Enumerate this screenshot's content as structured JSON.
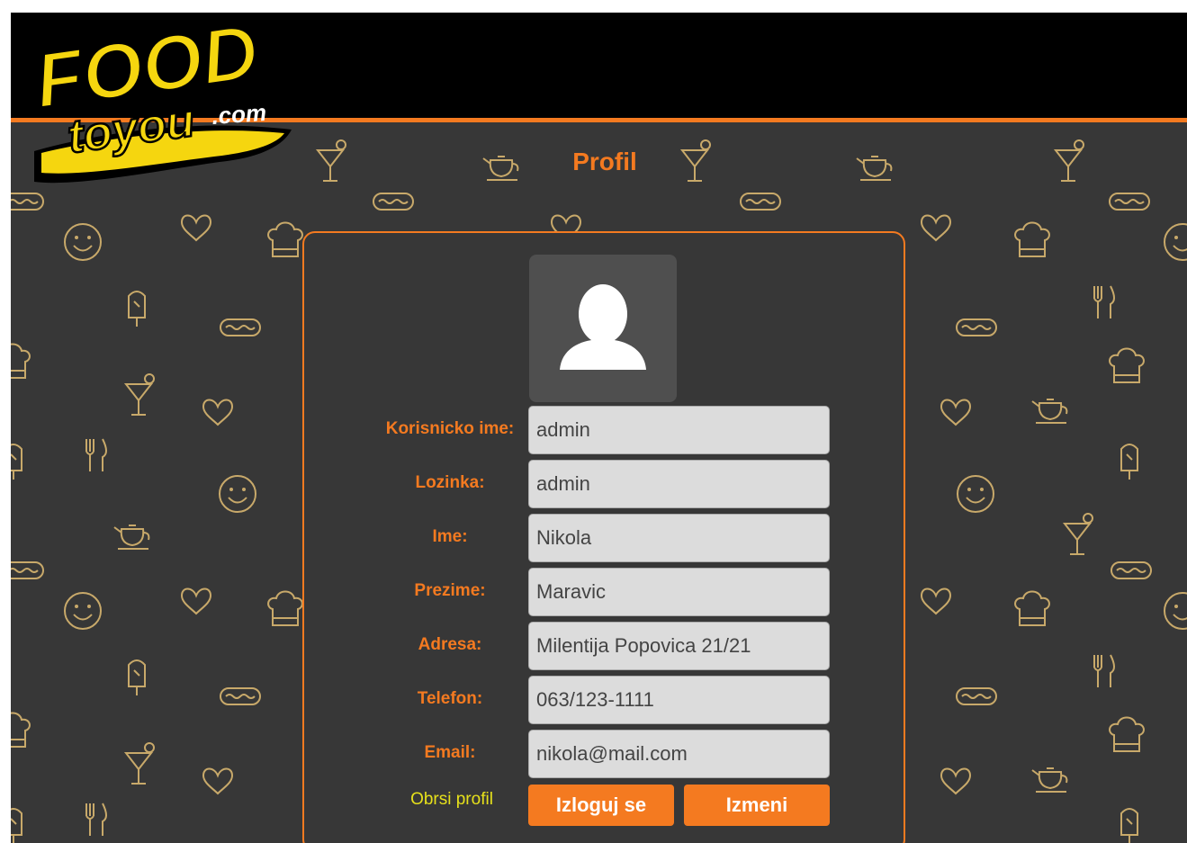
{
  "header": {
    "logo_text_main": "FOOD",
    "logo_text_sub": "toyou",
    "logo_text_domain": ".com"
  },
  "page": {
    "title": "Profil"
  },
  "profile": {
    "avatar_icon": "user-silhouette-icon",
    "fields": [
      {
        "label": "Korisnicko ime:",
        "value": "admin"
      },
      {
        "label": "Lozinka:",
        "value": "admin"
      },
      {
        "label": "Ime:",
        "value": "Nikola"
      },
      {
        "label": "Prezime:",
        "value": "Maravic"
      },
      {
        "label": "Adresa:",
        "value": "Milentija Popovica 21/21"
      },
      {
        "label": "Telefon:",
        "value": "063/123-1111"
      },
      {
        "label": "Email:",
        "value": "nikola@mail.com"
      }
    ]
  },
  "actions": {
    "delete_profile": "Obrsi profil",
    "logout": "Izloguj se",
    "edit": "Izmeni"
  },
  "colors": {
    "accent": "#f47a20",
    "background": "#373737",
    "header": "#000000",
    "logo_yellow": "#f5d60f",
    "delete_link": "#e6e01b",
    "pattern": "#c8a96a"
  }
}
